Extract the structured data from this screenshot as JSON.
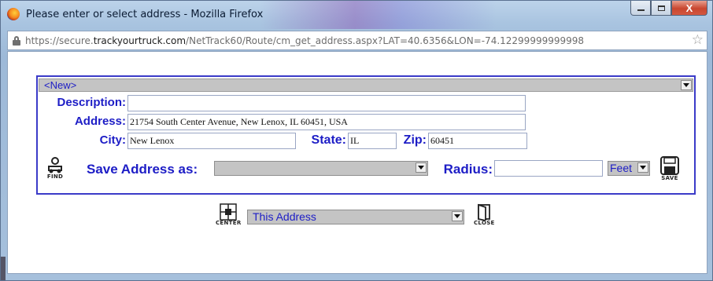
{
  "window": {
    "title": "Please enter or select address - Mozilla Firefox",
    "controls": {
      "minimize": "–",
      "maximize": "□",
      "close": "X"
    }
  },
  "urlbar": {
    "prefix": "https://secure.",
    "host": "trackyourtruck.com",
    "path": "/NetTrack60/Route/cm_get_address.aspx?LAT=40.6356&LON=-74.12299999999998"
  },
  "form": {
    "address_select": {
      "selected": "<New>"
    },
    "description": {
      "label": "Description:",
      "value": ""
    },
    "address": {
      "label": "Address:",
      "value": "21754 South Center Avenue, New Lenox, IL 60451, USA"
    },
    "city": {
      "label": "City:",
      "value": "New Lenox"
    },
    "state": {
      "label": "State:",
      "value": "IL"
    },
    "zip": {
      "label": "Zip:",
      "value": "60451"
    },
    "save_as": {
      "label": "Save Address as:",
      "selected": ""
    },
    "radius": {
      "label": "Radius:",
      "value": "",
      "unit": "Feet"
    },
    "find_button": {
      "caption": "FIND"
    },
    "save_button": {
      "caption": "SAVE"
    }
  },
  "bottom": {
    "center_button": {
      "caption": "CENTER"
    },
    "target_select": {
      "selected": "This Address"
    },
    "close_button": {
      "caption": "CLOSE"
    }
  },
  "colors": {
    "label_blue": "#1d1dc6",
    "panel_border": "#3b3bc8",
    "select_gray": "#c4c4c4"
  }
}
